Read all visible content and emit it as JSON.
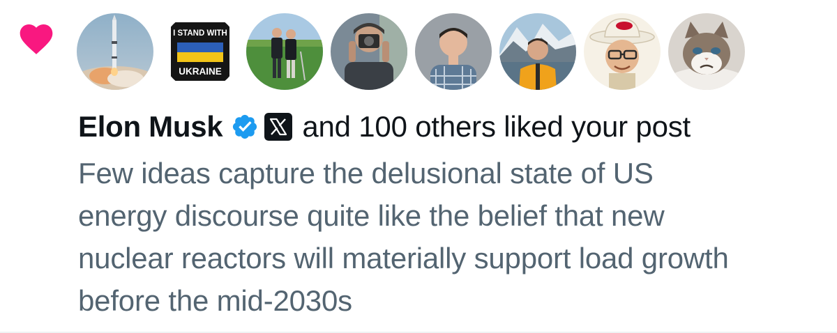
{
  "notification": {
    "type_icon": "heart-icon",
    "accent_color": "#f91880",
    "avatars": [
      {
        "name": "avatar-rocket-launch-icon"
      },
      {
        "name": "avatar-stand-with-ukraine-icon",
        "line1": "I STAND WITH",
        "line2": "UKRAINE"
      },
      {
        "name": "avatar-golfers-icon"
      },
      {
        "name": "avatar-photographer-icon"
      },
      {
        "name": "avatar-man-plaid-shirt-icon"
      },
      {
        "name": "avatar-man-orange-jacket-icon"
      },
      {
        "name": "avatar-man-cowboy-hat-icon"
      },
      {
        "name": "avatar-grumpy-cat-icon"
      }
    ],
    "author": "Elon Musk",
    "verified_icon": "verified-badge-icon",
    "affiliate_icon": "x-logo-icon",
    "action_text": "and 100 others liked your post",
    "post_lines": [
      "Few ideas capture the delusional state of US",
      "energy discourse quite like the belief that new",
      "nuclear reactors will materially support load growth",
      "before the mid-2030s"
    ]
  },
  "colors": {
    "primary_text": "#0f1419",
    "secondary_text": "#536471",
    "like_pink": "#f91880",
    "verified_blue": "#1d9bf0"
  }
}
